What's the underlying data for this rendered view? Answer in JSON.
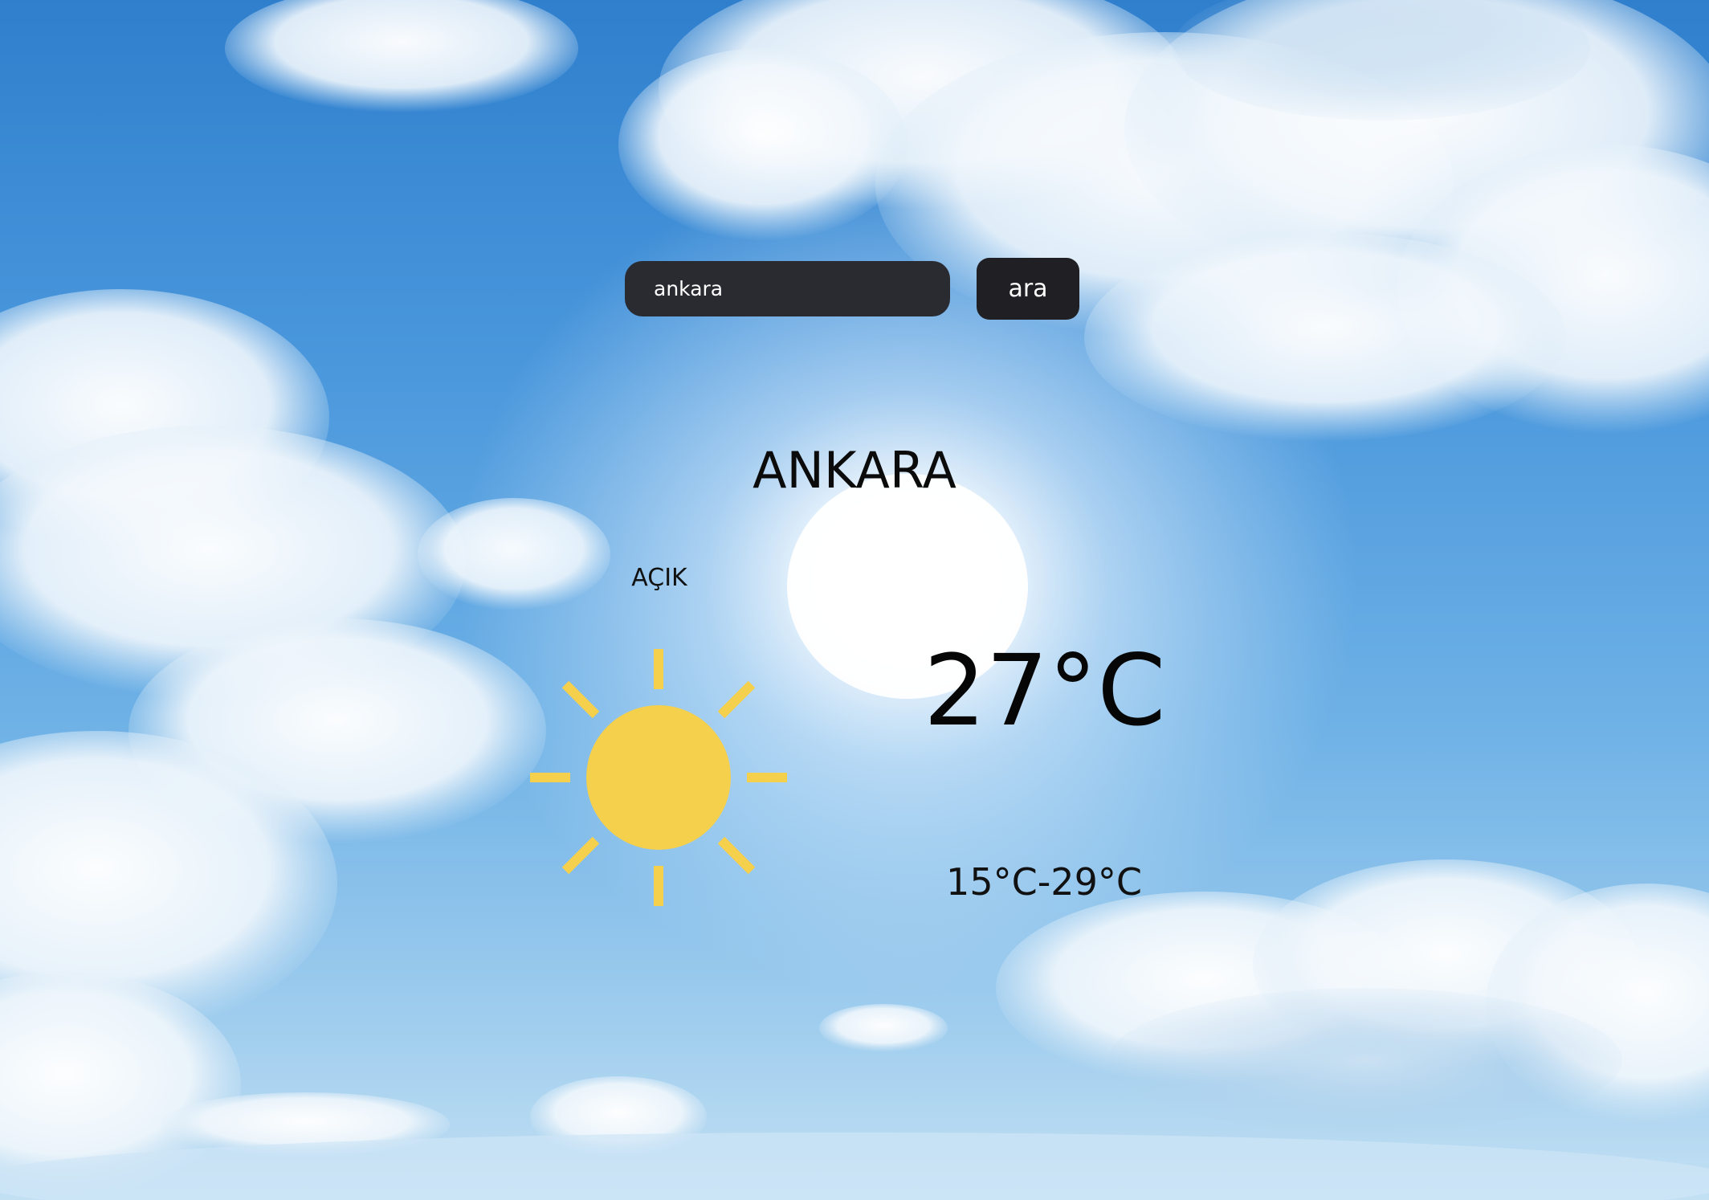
{
  "search": {
    "value": "ankara",
    "button_label": "ara"
  },
  "weather": {
    "city": "ANKARA",
    "condition": "AÇIK",
    "temperature": "27°C",
    "range": "15°C-29°C",
    "icon": "sun-icon"
  },
  "colors": {
    "sun": "#f5d04c",
    "input_bg": "#2a2a31",
    "button_bg": "#202024",
    "sky": "#4a97dc"
  }
}
